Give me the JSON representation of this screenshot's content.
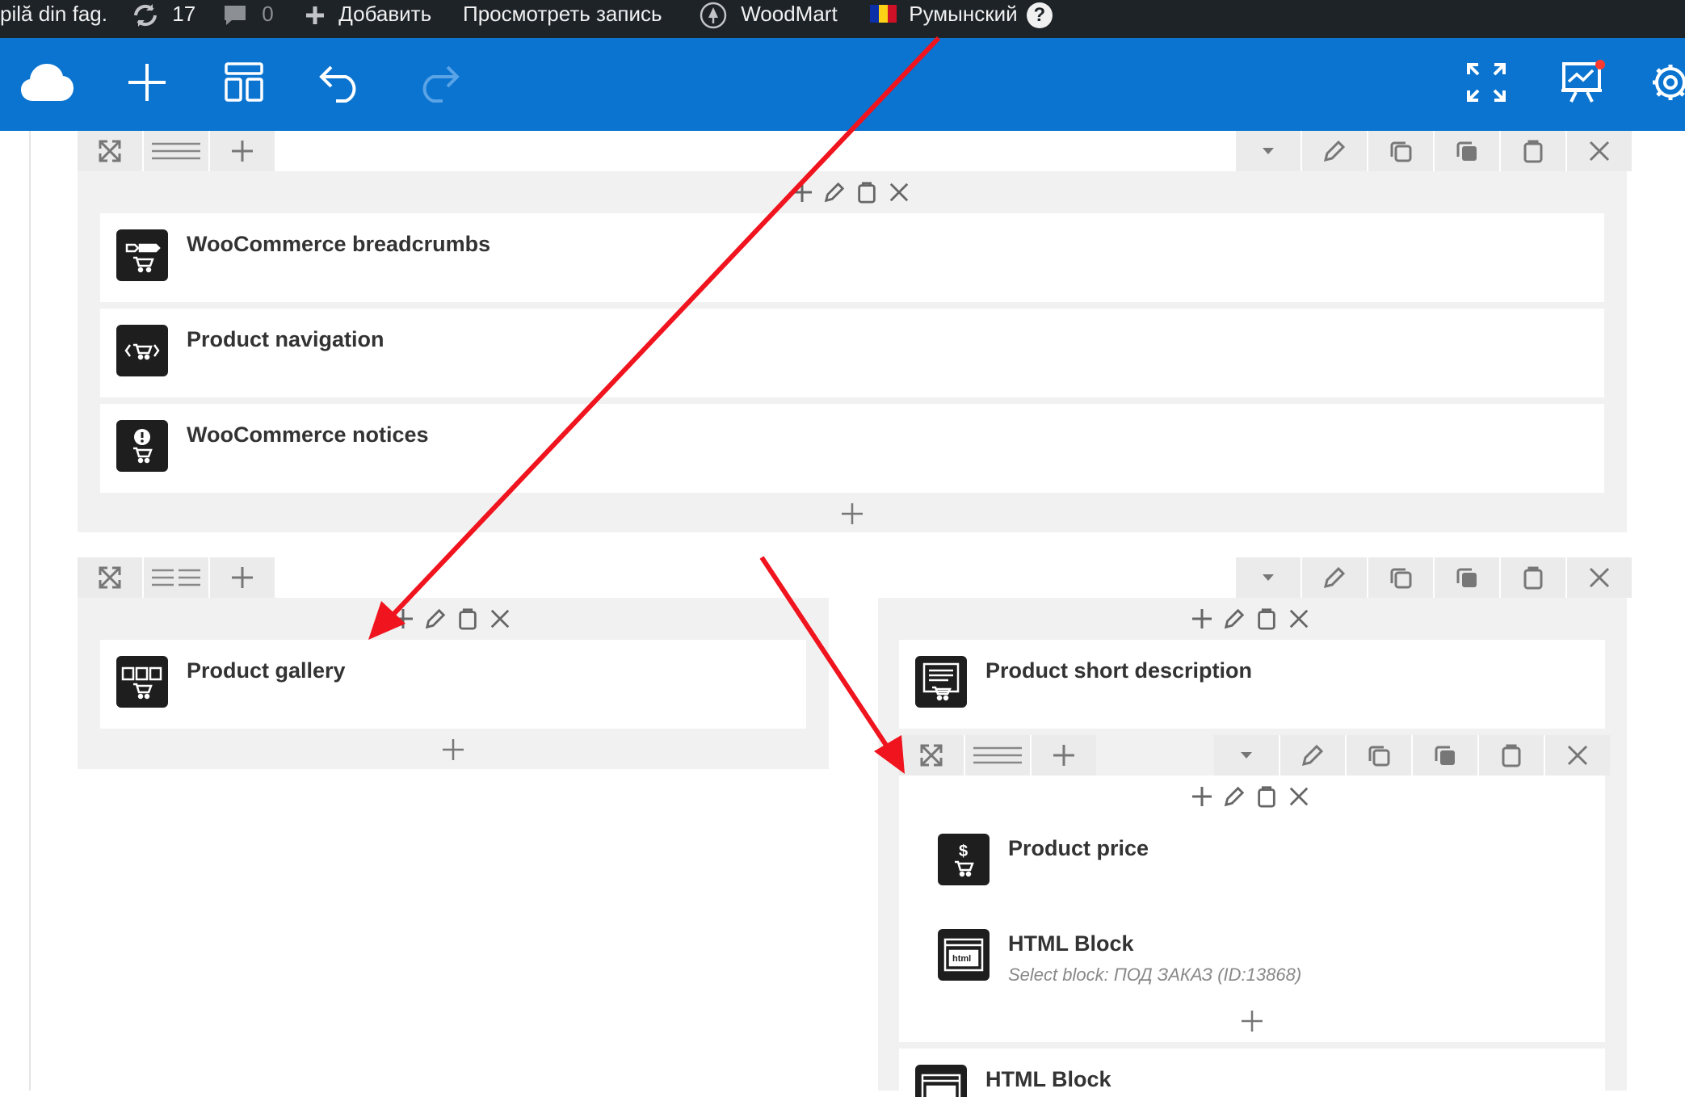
{
  "adminbar": {
    "site_name": "pilă din fag.",
    "updates_count": "17",
    "comments_count": "0",
    "add_label": "Добавить",
    "view_label": "Просмотреть запись",
    "theme_label": "WoodMart",
    "language_label": "Румынский",
    "help_label": "?"
  },
  "toolbar": {
    "icons": [
      "cloud-logo-icon",
      "add-icon",
      "layout-icon",
      "undo-icon",
      "redo-icon",
      "fullscreen-icon",
      "frontend-editor-icon",
      "settings-icon"
    ]
  },
  "colors": {
    "adminbar": "#1d2327",
    "toolbar": "#0a74d0",
    "annotation_arrow": "#f0141e",
    "icon_bg": "#1e1e1e"
  },
  "rows": [
    {
      "elements": [
        {
          "title": "WooCommerce breadcrumbs",
          "icon": "breadcrumbs-cart-icon"
        },
        {
          "title": "Product navigation",
          "icon": "navigation-cart-icon"
        },
        {
          "title": "WooCommerce notices",
          "icon": "notice-cart-icon"
        }
      ]
    },
    {
      "left_column": [
        {
          "title": "Product gallery",
          "icon": "gallery-cart-icon"
        }
      ],
      "right_column": [
        {
          "title": "Product short description",
          "icon": "description-cart-icon"
        }
      ],
      "inner_row": [
        {
          "title": "Product price",
          "icon": "price-cart-icon"
        },
        {
          "title": "HTML Block",
          "subtitle": "Select block: ПОД ЗАКАЗ (ID:13868)",
          "icon": "html-icon"
        }
      ],
      "after_inner": [
        {
          "title": "HTML Block",
          "icon": "html-icon"
        }
      ]
    }
  ]
}
